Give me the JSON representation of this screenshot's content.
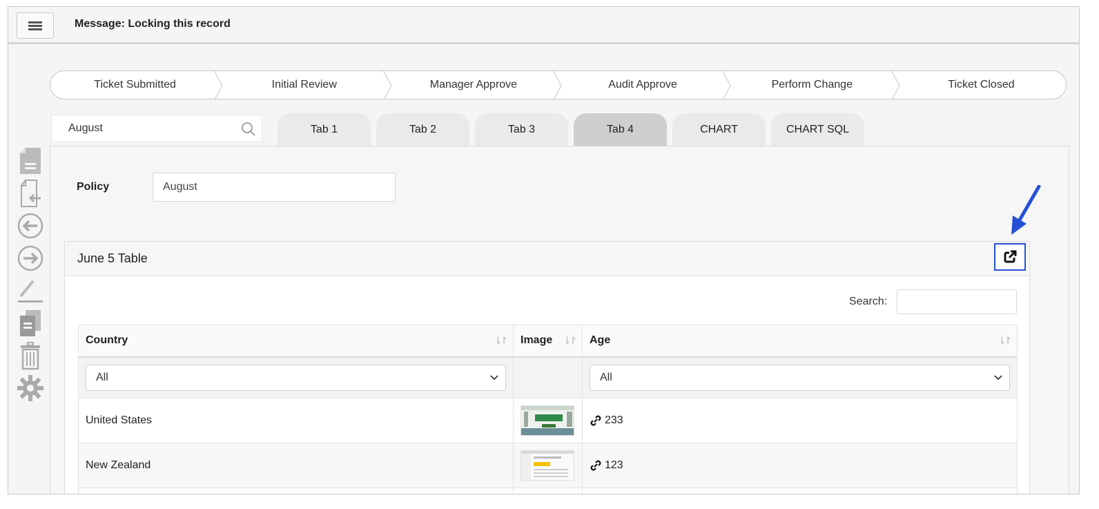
{
  "topbar": {
    "message": "Message: Locking this record"
  },
  "workflow": {
    "steps": [
      "Ticket Submitted",
      "Initial Review",
      "Manager Approve",
      "Audit Approve",
      "Perform Change",
      "Ticket Closed"
    ]
  },
  "search": {
    "value": "August"
  },
  "tabs": [
    {
      "label": "Tab 1"
    },
    {
      "label": "Tab 2"
    },
    {
      "label": "Tab 3"
    },
    {
      "label": "Tab 4",
      "active": true
    },
    {
      "label": "CHART"
    },
    {
      "label": "CHART SQL"
    }
  ],
  "form": {
    "policy_label": "Policy",
    "policy_value": "August"
  },
  "card": {
    "title": "June 5 Table",
    "search_label": "Search:",
    "columns": [
      "Country",
      "Image",
      "Age"
    ],
    "filters": {
      "country": "All",
      "age": "All"
    },
    "rows": [
      {
        "country": "United States",
        "age": "233"
      },
      {
        "country": "New Zealand",
        "age": "123"
      }
    ]
  },
  "colors": {
    "annotation": "#2550d6",
    "active_tab": "#cfcfcf",
    "tab": "#eaeaea"
  }
}
